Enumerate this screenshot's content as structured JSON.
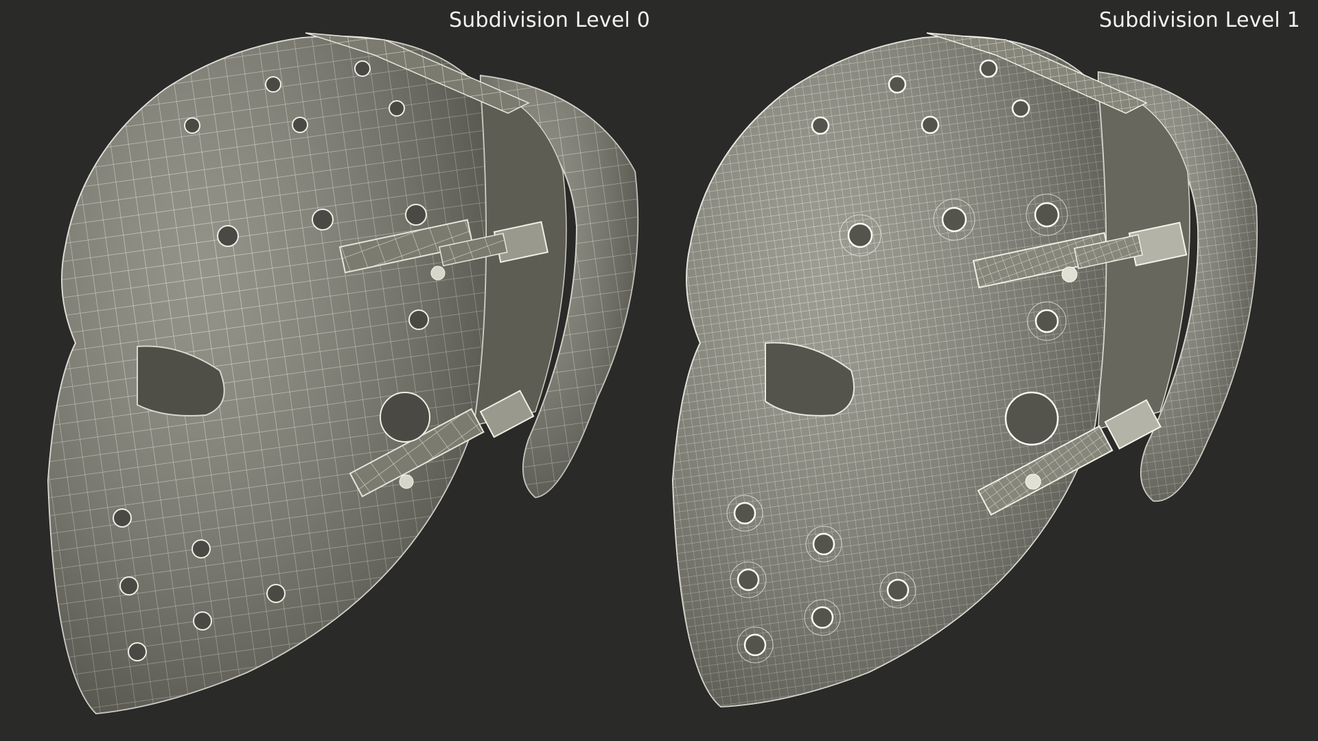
{
  "labels": {
    "left": "Subdivision Level 0",
    "right": "Subdivision Level 1"
  },
  "colors": {
    "background": "#2a2a29",
    "mesh_fill_level0": "#7c7b6f",
    "mesh_fill_level1": "#8a8a7e",
    "wire_level0": "#e6e6dc",
    "wire_level1": "#f0f0e6",
    "label_text": "#f2f2f2"
  }
}
